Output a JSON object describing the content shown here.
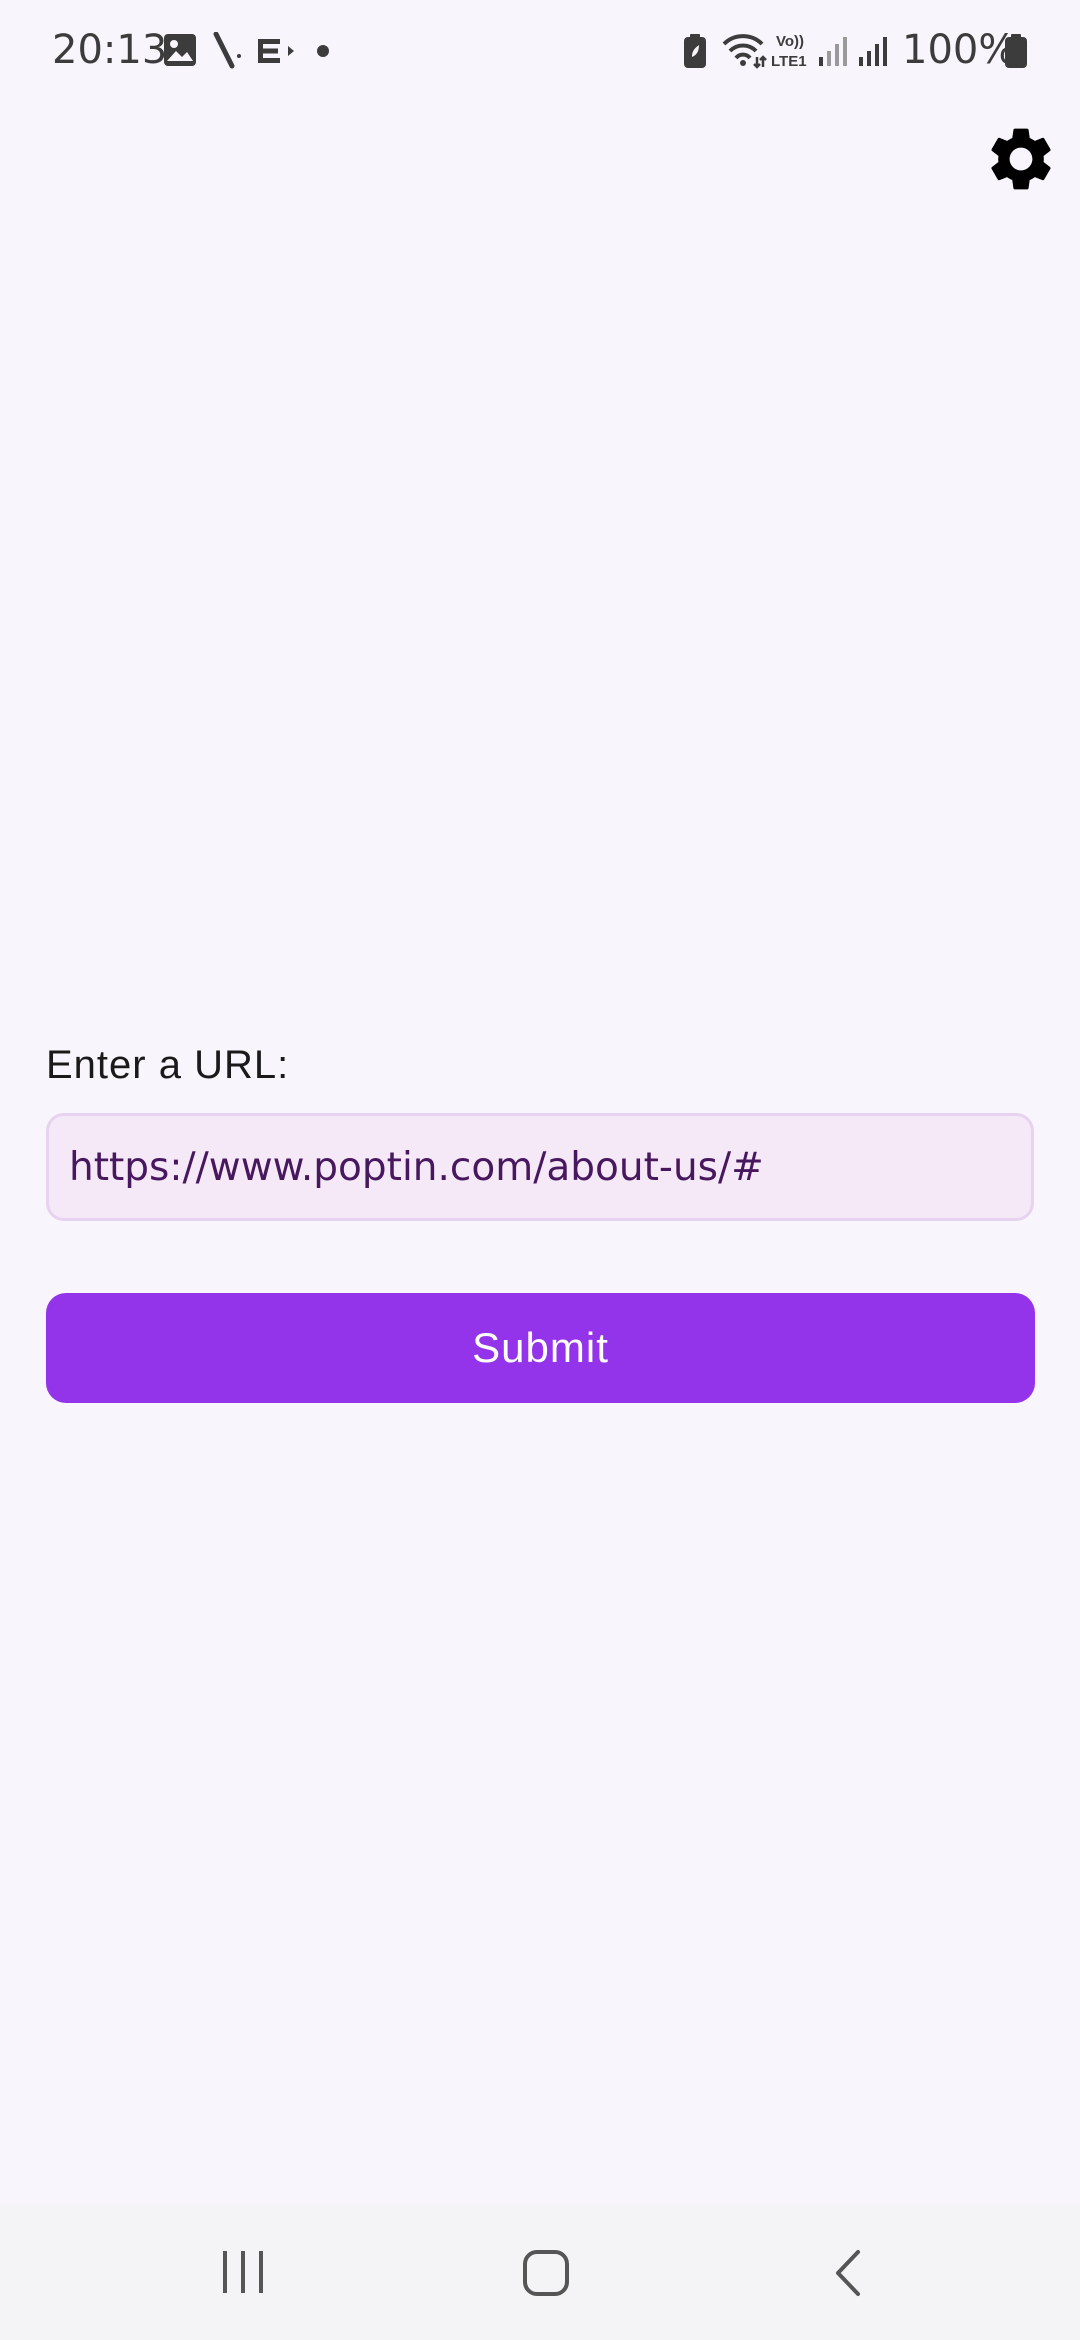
{
  "status_bar": {
    "time": "20:13",
    "notification_icons": [
      "gallery-icon",
      "signal-app-icon",
      "media-output-icon",
      "dot-icon"
    ],
    "system_icons": [
      "battery-saver-icon",
      "wifi-icon",
      "volte-lte1-icon",
      "signal-icon",
      "signal-icon"
    ],
    "volte_top": "Vo))",
    "volte_bottom": "LTE1",
    "battery_percent": "100%"
  },
  "header": {
    "settings_icon": "gear-icon"
  },
  "form": {
    "label": "Enter a URL:",
    "url_value": "https://www.poptin.com/about-us/#",
    "submit_label": "Submit"
  },
  "colors": {
    "background": "#f9f5fc",
    "accent": "#9333ea",
    "input_background": "#f5e9f8",
    "input_border": "#e7d2f0",
    "input_text": "#48185f"
  },
  "nav_bar": {
    "items": [
      "recent-apps-icon",
      "home-icon",
      "back-icon"
    ]
  }
}
